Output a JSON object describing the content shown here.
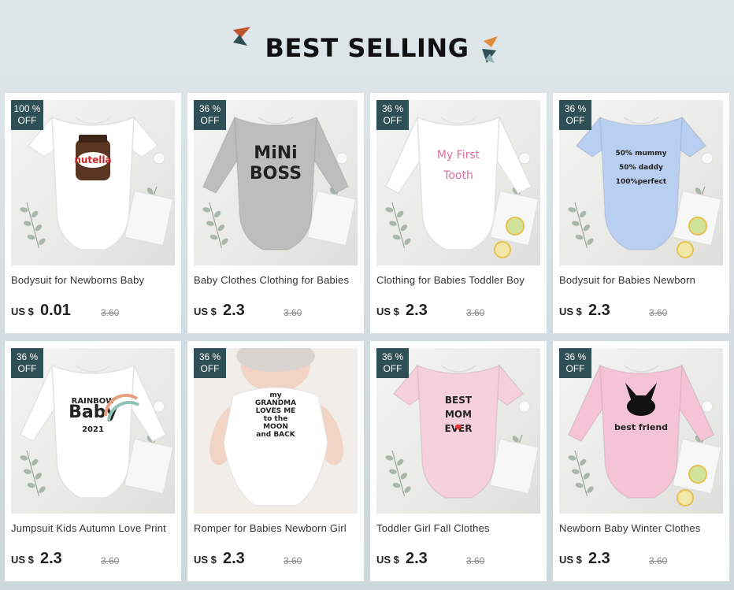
{
  "header": {
    "title": "BEST SELLING"
  },
  "products": [
    {
      "name": "Bodysuit for Newborns Baby",
      "discount_pct": "100 %",
      "discount_off": "OFF",
      "currency": "US $",
      "price": "0.01",
      "old_price": "3.60",
      "garment": "short",
      "color": "#ffffff",
      "print_lines": [
        "nutella"
      ]
    },
    {
      "name": "Baby Clothes Clothing for Babies",
      "discount_pct": "36  %",
      "discount_off": "OFF",
      "currency": "US $",
      "price": "2.3",
      "old_price": "3.60",
      "garment": "long",
      "color": "#bdbdbd",
      "print_lines": [
        "MiNi",
        "BOSS"
      ]
    },
    {
      "name": "Clothing for Babies Toddler Boy",
      "discount_pct": "36  %",
      "discount_off": "OFF",
      "currency": "US $",
      "price": "2.3",
      "old_price": "3.60",
      "garment": "long",
      "color": "#ffffff",
      "print_lines": [
        "My First",
        "Tooth"
      ]
    },
    {
      "name": "Bodysuit for Babies Newborn",
      "discount_pct": "36  %",
      "discount_off": "OFF",
      "currency": "US $",
      "price": "2.3",
      "old_price": "3.60",
      "garment": "short",
      "color": "#b8cff2",
      "print_lines": [
        "50% mummy",
        "50% daddy",
        "100%perfect"
      ]
    },
    {
      "name": "Jumpsuit Kids Autumn Love Print",
      "discount_pct": "36  %",
      "discount_off": "OFF",
      "currency": "US $",
      "price": "2.3",
      "old_price": "3.60",
      "garment": "long",
      "color": "#ffffff",
      "print_lines": [
        "RAINBOW",
        "Baby",
        "2021"
      ]
    },
    {
      "name": "Romper for Babies Newborn Girl",
      "discount_pct": "36  %",
      "discount_off": "OFF",
      "currency": "US $",
      "price": "2.3",
      "old_price": "3.60",
      "garment": "baby",
      "color": "#ffffff",
      "print_lines": [
        "my",
        "GRANDMA",
        "LOVES ME",
        "to the",
        "MOON",
        "and BACK"
      ]
    },
    {
      "name": "Toddler Girl Fall Clothes",
      "discount_pct": "36  %",
      "discount_off": "OFF",
      "currency": "US $",
      "price": "2.3",
      "old_price": "3.60",
      "garment": "short",
      "color": "#f6cfdc",
      "print_lines": [
        "BEST",
        "MOM",
        "EVER"
      ]
    },
    {
      "name": "Newborn Baby Winter Clothes",
      "discount_pct": "36  %",
      "discount_off": "OFF",
      "currency": "US $",
      "price": "2.3",
      "old_price": "3.60",
      "garment": "long",
      "color": "#f4c4d6",
      "print_lines": [
        "best friend"
      ]
    }
  ]
}
